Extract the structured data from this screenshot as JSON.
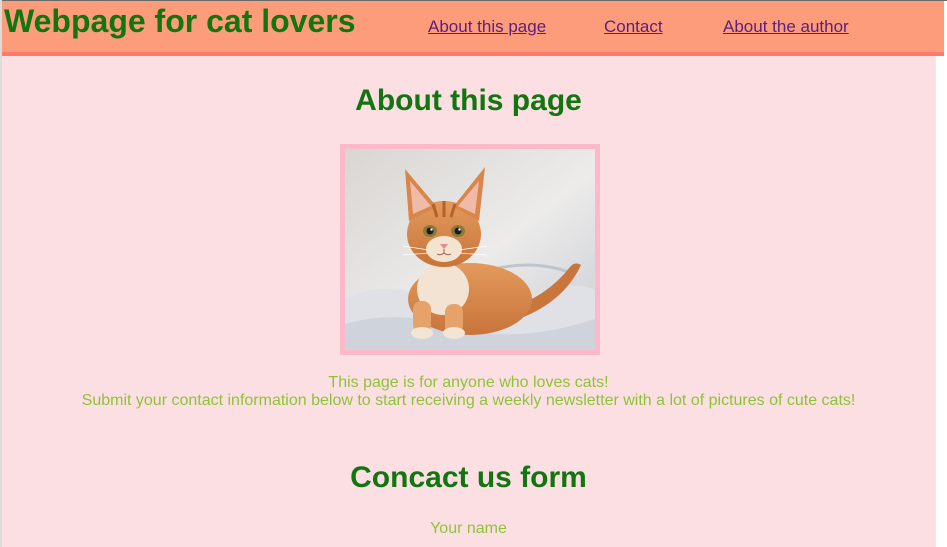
{
  "header": {
    "site_title": "Webpage for cat lovers",
    "nav": [
      {
        "label": "About this page"
      },
      {
        "label": "Contact"
      },
      {
        "label": "About the author"
      }
    ]
  },
  "about": {
    "heading": "About this page",
    "image_icon": "cat-photo",
    "line1": "This page is for anyone who loves cats!",
    "line2": "Submit your contact information below to start receiving a weekly newsletter with a lot of pictures of cute cats!"
  },
  "contact_form": {
    "heading": "Concact us form",
    "name_label": "Your name"
  },
  "colors": {
    "header_bg": "#fd9c7b",
    "header_border": "#fb7c68",
    "page_bg": "#fbdfe3",
    "title_green": "#13750f",
    "text_green": "#8fc337",
    "link_purple": "#5b1f7d",
    "image_border": "#fdb9c9"
  }
}
